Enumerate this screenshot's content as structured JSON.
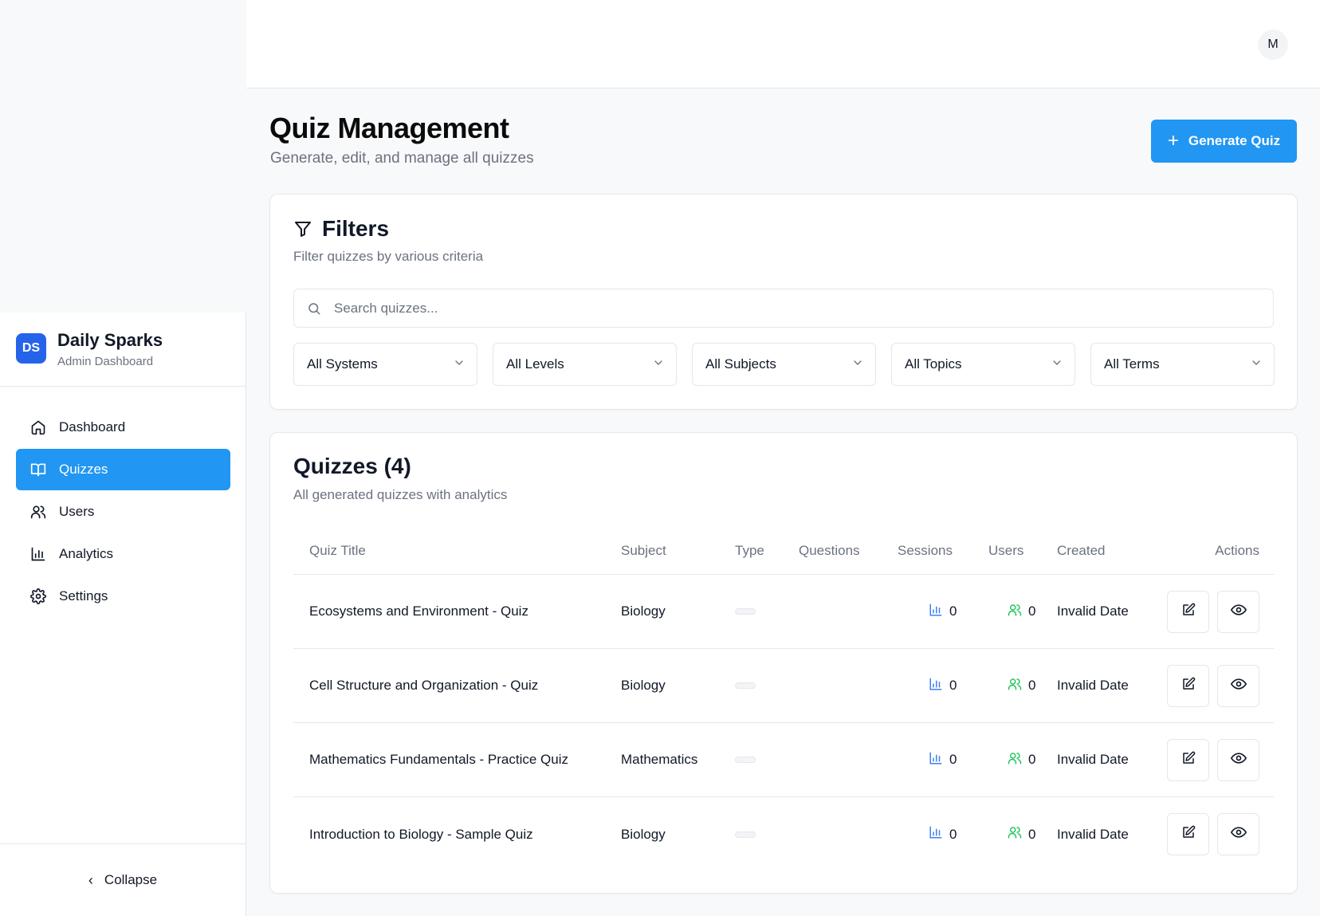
{
  "brand": {
    "logo": "DS",
    "name": "Daily Sparks",
    "subtitle": "Admin Dashboard"
  },
  "sidebar": {
    "items": [
      {
        "label": "Dashboard",
        "icon": "home-icon"
      },
      {
        "label": "Quizzes",
        "icon": "book-open-icon",
        "active": true
      },
      {
        "label": "Users",
        "icon": "users-icon"
      },
      {
        "label": "Analytics",
        "icon": "bar-chart-icon"
      },
      {
        "label": "Settings",
        "icon": "gear-icon"
      }
    ],
    "collapse_label": "Collapse"
  },
  "header": {
    "avatar_initial": "M"
  },
  "page": {
    "title": "Quiz Management",
    "subtitle": "Generate, edit, and manage all quizzes",
    "generate_button": "Generate Quiz"
  },
  "filters": {
    "title": "Filters",
    "subtitle": "Filter quizzes by various criteria",
    "search_placeholder": "Search quizzes...",
    "selects": [
      "All Systems",
      "All Levels",
      "All Subjects",
      "All Topics",
      "All Terms"
    ]
  },
  "quizzes": {
    "title": "Quizzes (4)",
    "subtitle": "All generated quizzes with analytics",
    "columns": [
      "Quiz Title",
      "Subject",
      "Type",
      "Questions",
      "Sessions",
      "Users",
      "Created",
      "Actions"
    ],
    "rows": [
      {
        "title": "Ecosystems and Environment - Quiz",
        "subject": "Biology",
        "questions": "",
        "sessions": "0",
        "users": "0",
        "created": "Invalid Date"
      },
      {
        "title": "Cell Structure and Organization - Quiz",
        "subject": "Biology",
        "questions": "",
        "sessions": "0",
        "users": "0",
        "created": "Invalid Date"
      },
      {
        "title": "Mathematics Fundamentals - Practice Quiz",
        "subject": "Mathematics",
        "questions": "",
        "sessions": "0",
        "users": "0",
        "created": "Invalid Date"
      },
      {
        "title": "Introduction to Biology - Sample Quiz",
        "subject": "Biology",
        "questions": "",
        "sessions": "0",
        "users": "0",
        "created": "Invalid Date"
      }
    ]
  },
  "colors": {
    "accent": "#2196f3",
    "brand": "#2563eb",
    "sessions_icon": "#3b82f6",
    "users_icon": "#22c55e"
  }
}
